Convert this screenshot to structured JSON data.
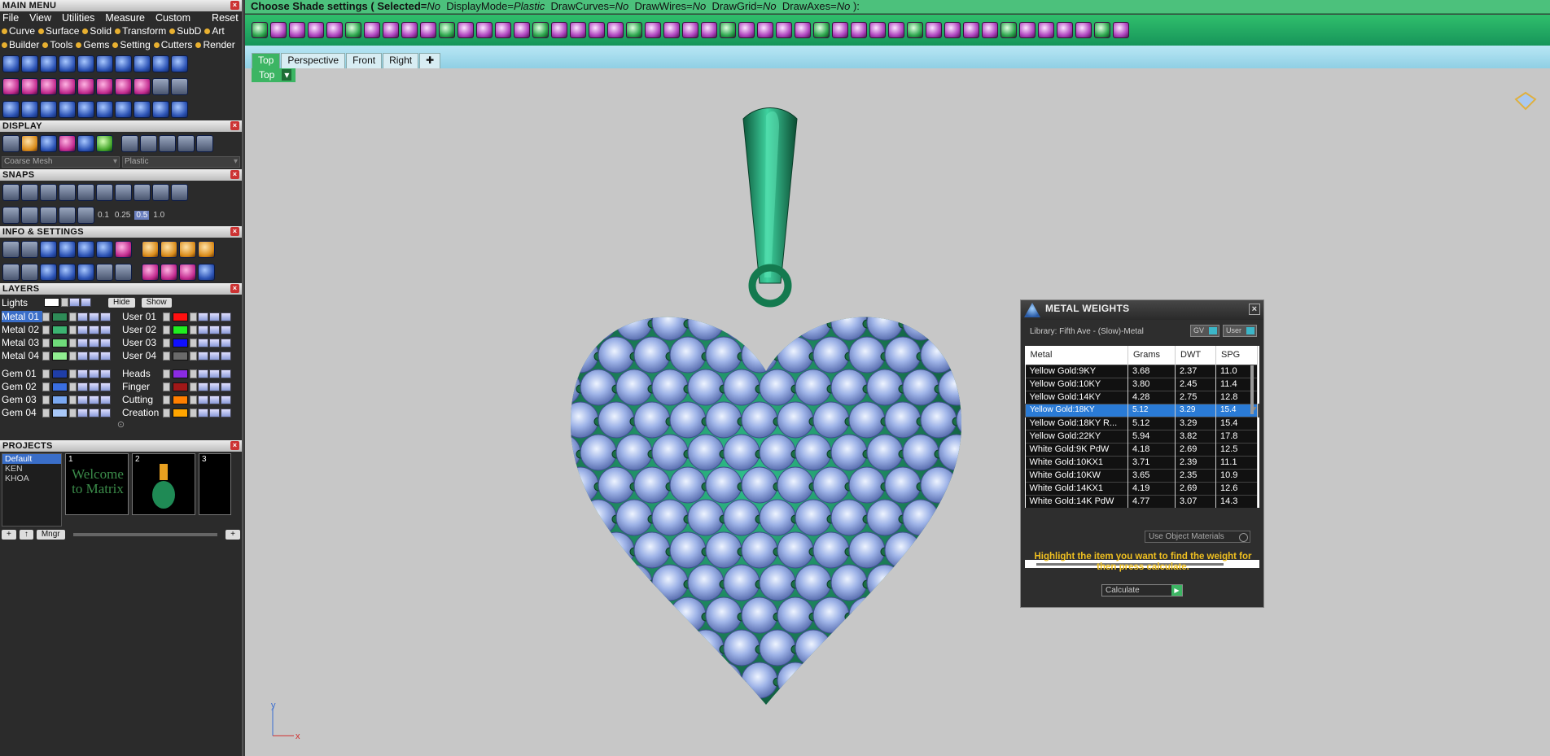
{
  "left": {
    "main_menu_title": "MAIN MENU",
    "menu": [
      "File",
      "View",
      "Utilities",
      "Measure",
      "Custom"
    ],
    "reset": "Reset",
    "modules_row1": [
      "Curve",
      "Surface",
      "Solid",
      "Transform",
      "SubD",
      "Art"
    ],
    "modules_row2": [
      "Builder",
      "Tools",
      "Gems",
      "Setting",
      "Cutters",
      "Render"
    ],
    "display_title": "DISPLAY",
    "mesh_mode": "Coarse Mesh",
    "material_mode": "Plastic",
    "snaps_title": "SNAPS",
    "snap_values": [
      "0.1",
      "0.25",
      "0.5",
      "1.0"
    ],
    "snap_selected": "0.5",
    "info_title": "INFO & SETTINGS",
    "layers_title": "LAYERS",
    "lights_label": "Lights",
    "hide_label": "Hide",
    "show_label": "Show",
    "layers_left": [
      {
        "name": "Metal 01",
        "color": "#2e8b57",
        "active": true
      },
      {
        "name": "Metal 02",
        "color": "#3cb371"
      },
      {
        "name": "Metal 03",
        "color": "#6fdc7a"
      },
      {
        "name": "Metal 04",
        "color": "#90ee90"
      },
      {
        "name": "Gem 01",
        "color": "#1f3ea8"
      },
      {
        "name": "Gem 02",
        "color": "#3a6ee0"
      },
      {
        "name": "Gem 03",
        "color": "#7aa8f0"
      },
      {
        "name": "Gem 04",
        "color": "#a8c8f8"
      }
    ],
    "layers_right": [
      {
        "name": "User 01",
        "color": "#ff1010"
      },
      {
        "name": "User 02",
        "color": "#20ee20"
      },
      {
        "name": "User 03",
        "color": "#1010ff"
      },
      {
        "name": "User 04",
        "color": "#6a6a6a"
      },
      {
        "name": "Heads",
        "color": "#8a2be2"
      },
      {
        "name": "Finger",
        "color": "#a01818"
      },
      {
        "name": "Cutting",
        "color": "#ff7f00"
      },
      {
        "name": "Creation",
        "color": "#ffa500"
      }
    ],
    "projects_title": "PROJECTS",
    "projects": [
      "Default",
      "KEN",
      "KHOA"
    ],
    "thumbs": [
      "1",
      "2",
      "3"
    ],
    "thumb1_text": "Welcome to Matrix",
    "mngr": "Mngr"
  },
  "command_bar": {
    "prefix": "Choose Shade settings ( ",
    "selected_label": "Selected=",
    "selected_val": "No",
    "display_label": "DisplayMode=",
    "display_val": "Plastic",
    "curves_label": "DrawCurves=",
    "curves_val": "No",
    "wires_label": "DrawWires=",
    "wires_val": "No",
    "grid_label": "DrawGrid=",
    "grid_val": "No",
    "axes_label": "DrawAxes=",
    "axes_val": "No",
    "suffix": " ):"
  },
  "tabs": [
    "Top",
    "Perspective",
    "Front",
    "Right"
  ],
  "viewport": {
    "label": "Top",
    "axis_y": "y",
    "axis_x": "x"
  },
  "metal_weights": {
    "title": "METAL WEIGHTS",
    "library": "Library: Fifth Ave - (Slow)-Metal",
    "chip1": "GV",
    "chip2": "User",
    "columns": [
      "Metal",
      "Grams",
      "DWT",
      "SPG"
    ],
    "rows": [
      [
        "Yellow Gold:9KY",
        "3.68",
        "2.37",
        "11.0"
      ],
      [
        "Yellow Gold:10KY",
        "3.80",
        "2.45",
        "11.4"
      ],
      [
        "Yellow Gold:14KY",
        "4.28",
        "2.75",
        "12.8"
      ],
      [
        "Yellow Gold:18KY",
        "5.12",
        "3.29",
        "15.4"
      ],
      [
        "Yellow Gold:18KY R...",
        "5.12",
        "3.29",
        "15.4"
      ],
      [
        "Yellow Gold:22KY",
        "5.94",
        "3.82",
        "17.8"
      ],
      [
        "White Gold:9K PdW",
        "4.18",
        "2.69",
        "12.5"
      ],
      [
        "White Gold:10KX1",
        "3.71",
        "2.39",
        "11.1"
      ],
      [
        "White Gold:10KW",
        "3.65",
        "2.35",
        "10.9"
      ],
      [
        "White Gold:14KX1",
        "4.19",
        "2.69",
        "12.6"
      ],
      [
        "White Gold:14K PdW",
        "4.77",
        "3.07",
        "14.3"
      ]
    ],
    "selected_row": 3,
    "use_object_materials": "Use Object Materials",
    "hint": "Highlight the item you want to find the weight for then press calculate.",
    "calculate": "Calculate"
  }
}
